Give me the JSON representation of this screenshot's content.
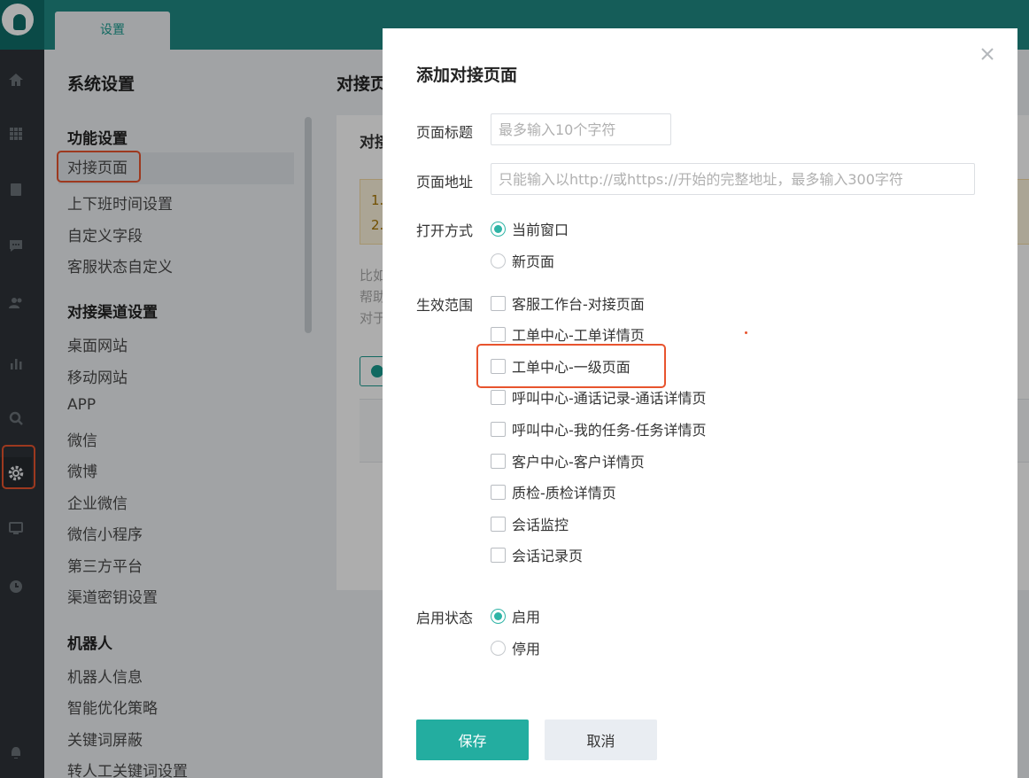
{
  "topbar": {
    "tab_label": "设置"
  },
  "menu": {
    "title": "系统设置",
    "groups": [
      {
        "label": "功能设置",
        "items": [
          "对接页面",
          "上下班时间设置",
          "自定义字段",
          "客服状态自定义"
        ]
      },
      {
        "label": "对接渠道设置",
        "items": [
          "桌面网站",
          "移动网站",
          "APP",
          "微信",
          "微博",
          "企业微信",
          "微信小程序",
          "第三方平台",
          "渠道密钥设置"
        ]
      },
      {
        "label": "机器人",
        "items": [
          "机器人信息",
          "智能优化策略",
          "关键词屏蔽",
          "转人工关键词设置"
        ]
      }
    ]
  },
  "content": {
    "title": "对接页",
    "card_title": "对接",
    "tip_lines": [
      "1.",
      "2."
    ],
    "text_lines": [
      "比如",
      "帮助",
      "对于"
    ]
  },
  "modal": {
    "title": "添加对接页面",
    "page_title_label": "页面标题",
    "page_title_placeholder": "最多输入10个字符",
    "page_url_label": "页面地址",
    "page_url_placeholder": "只能输入以http://或https://开始的完整地址，最多输入300字符",
    "open_mode_label": "打开方式",
    "open_mode_options": [
      "当前窗口",
      "新页面"
    ],
    "open_mode_selected": "当前窗口",
    "scope_label": "生效范围",
    "scope_options": [
      "客服工作台-对接页面",
      "工单中心-工单详情页",
      "工单中心-一级页面",
      "呼叫中心-通话记录-通话详情页",
      "呼叫中心-我的任务-任务详情页",
      "客户中心-客户详情页",
      "质检-质检详情页",
      "会话监控",
      "会话记录页"
    ],
    "status_label": "启用状态",
    "status_options": [
      "启用",
      "停用"
    ],
    "status_selected": "启用",
    "save_label": "保存",
    "cancel_label": "取消"
  },
  "colors": {
    "brand": "#1f8a84",
    "accent": "#23ada0",
    "highlight": "#e8542e"
  },
  "icons": [
    "home-icon",
    "apps-icon",
    "book-icon",
    "chat-icon",
    "users-icon",
    "chart-icon",
    "search-icon",
    "gear-icon",
    "monitor-icon",
    "clock-icon",
    "bell-icon",
    "close-icon"
  ]
}
